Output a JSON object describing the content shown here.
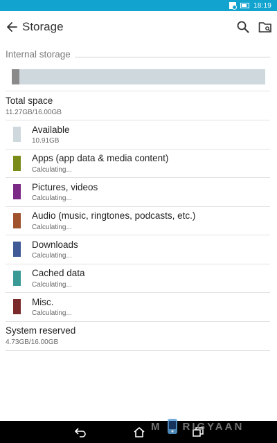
{
  "status_bar": {
    "time": "18:19",
    "background": "#12a3cf"
  },
  "app_bar": {
    "title": "Storage",
    "icons": [
      "back-arrow-icon",
      "search-icon",
      "explore-folder-icon"
    ]
  },
  "section": {
    "header": "Internal storage"
  },
  "usage_bar": {
    "used_fraction": 0.03,
    "used_color": "#8a8a8a",
    "track_color": "#cfd8dc"
  },
  "total": {
    "title": "Total space",
    "value": "11.27GB/16.00GB"
  },
  "categories": [
    {
      "label": "Available",
      "value": "10.91GB",
      "color": "#cfd8dc"
    },
    {
      "label": "Apps (app data & media content)",
      "value": "Calculating...",
      "color": "#7a8b1a"
    },
    {
      "label": "Pictures, videos",
      "value": "Calculating...",
      "color": "#7b2a85"
    },
    {
      "label": "Audio (music, ringtones, podcasts, etc.)",
      "value": "Calculating...",
      "color": "#a0522d"
    },
    {
      "label": "Downloads",
      "value": "Calculating...",
      "color": "#3f5a97"
    },
    {
      "label": "Cached data",
      "value": "Calculating...",
      "color": "#3a9a95"
    },
    {
      "label": "Misc.",
      "value": "Calculating...",
      "color": "#7a2a2a"
    }
  ],
  "system_reserved": {
    "title": "System reserved",
    "value": "4.73GB/16.00GB"
  },
  "nav_bar": {
    "icons": [
      "back-nav-icon",
      "home-nav-icon",
      "recents-nav-icon"
    ]
  },
  "watermark": {
    "text_left": "M",
    "text_right": "RIGYAAN"
  }
}
